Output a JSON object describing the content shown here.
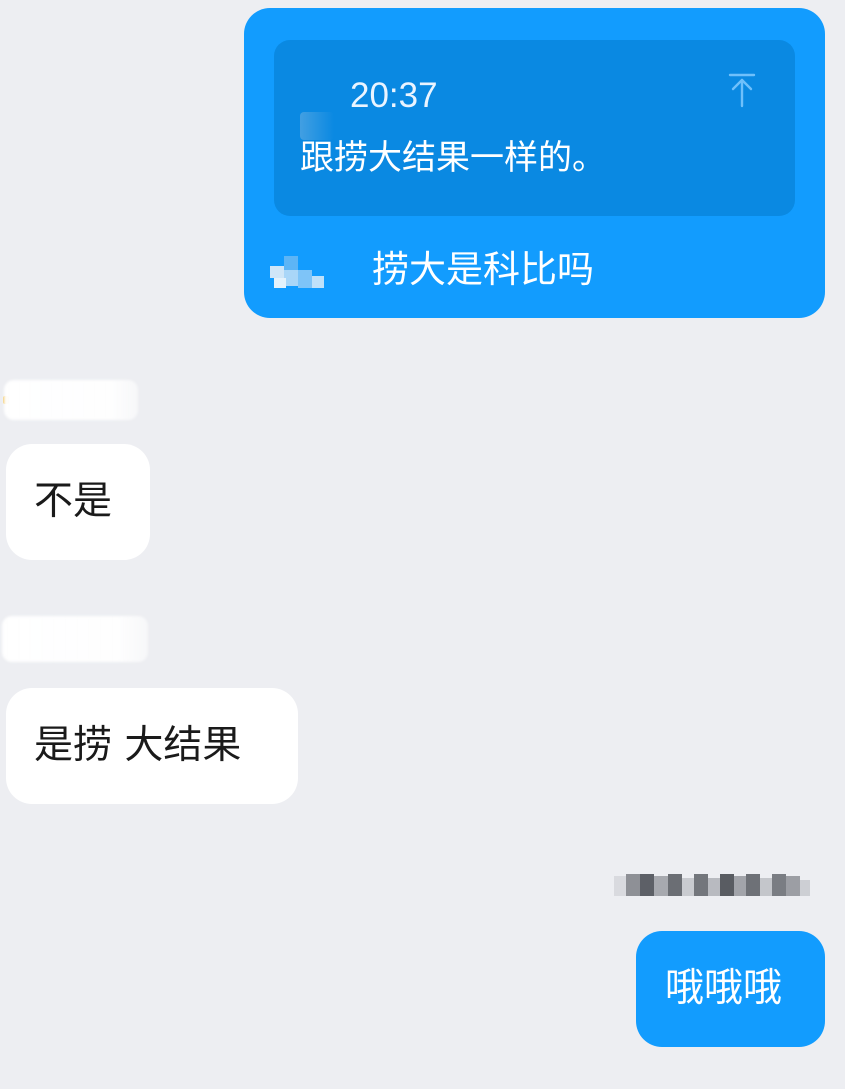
{
  "chat": {
    "reply_message": {
      "quote": {
        "time": "20:37",
        "text": "跟捞大结果一样的。",
        "jump_icon": "arrow-up-to-top-icon"
      },
      "text": "捞大是科比吗"
    },
    "messages": [
      {
        "direction": "incoming",
        "text": "不是"
      },
      {
        "direction": "incoming",
        "text": "是捞 大结果"
      },
      {
        "direction": "outgoing",
        "text": "哦哦哦"
      }
    ]
  },
  "colors": {
    "background": "#EDEEF2",
    "outgoing_bubble": "#129CFE",
    "quote_box": "#0A89E2",
    "incoming_bubble": "#FFFFFF",
    "incoming_text": "#1A1A1A"
  }
}
